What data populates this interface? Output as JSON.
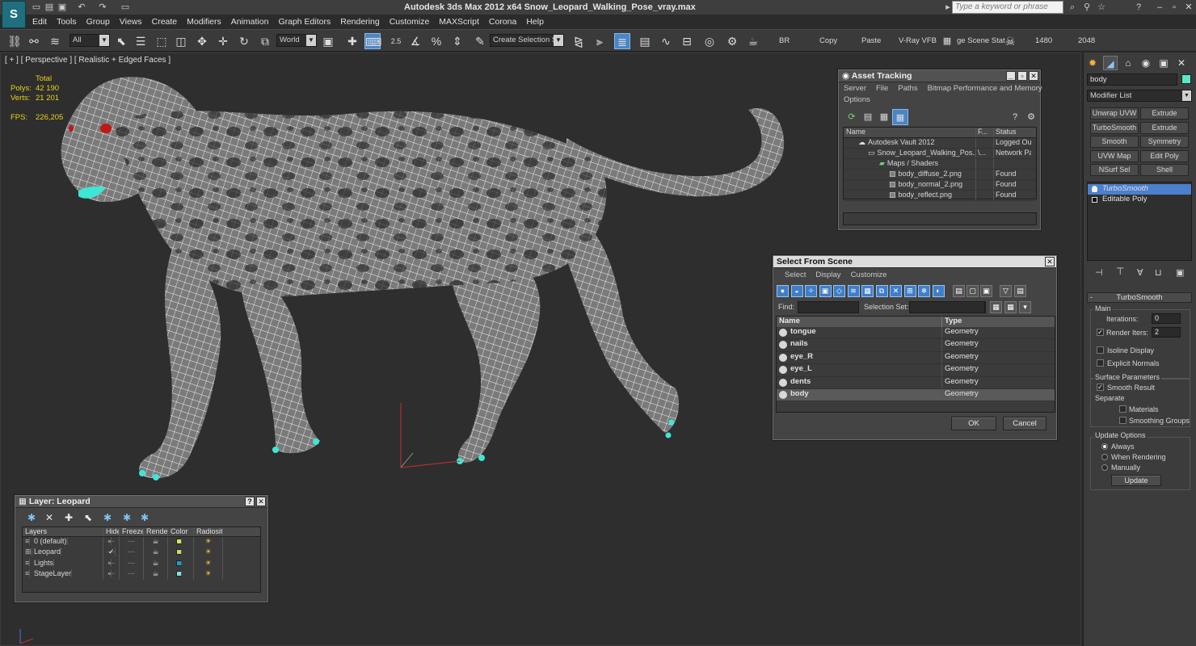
{
  "app": {
    "title": "Autodesk 3ds Max  2012 x64      Snow_Leopard_Walking_Pose_vray.max",
    "logo": "S",
    "search_placeholder": "Type a keyword or phrase"
  },
  "menu": [
    "Edit",
    "Tools",
    "Group",
    "Views",
    "Create",
    "Modifiers",
    "Animation",
    "Graph Editors",
    "Rendering",
    "Customize",
    "MAXScript",
    "Corona",
    "Help"
  ],
  "toolbar": {
    "filter": "All",
    "coord": "World",
    "selection_set": "Create Selection Se",
    "snap_num": "2.5",
    "labels": [
      "BR",
      "Copy",
      "Paste",
      "V-Ray VFB",
      "ge Scene Stat",
      "1480",
      "2048"
    ]
  },
  "viewport": {
    "label": "[ + ] [ Perspective ] [ Realistic + Edged Faces ]",
    "stats": {
      "total_label": "Total",
      "polys_label": "Polys:",
      "polys": "42 190",
      "verts_label": "Verts:",
      "verts": "21 201",
      "fps_label": "FPS:",
      "fps": "226,205"
    }
  },
  "asset_tracking": {
    "title": "Asset Tracking",
    "menu": [
      "Server",
      "File",
      "Paths",
      "Bitmap Performance and Memory"
    ],
    "menu2": "Options",
    "columns": [
      "Name",
      "F...",
      "Status"
    ],
    "rows": [
      {
        "name": "Autodesk Vault 2012",
        "f": "",
        "status": "Logged Out"
      },
      {
        "name": "Snow_Leopard_Walking_Pos...",
        "f": "\\...",
        "status": "Network Pa"
      },
      {
        "name": "Maps / Shaders",
        "f": "",
        "status": ""
      },
      {
        "name": "body_diffuse_2.png",
        "f": "",
        "status": "Found"
      },
      {
        "name": "body_normal_2.png",
        "f": "",
        "status": "Found"
      },
      {
        "name": "body_reflect.png",
        "f": "",
        "status": "Found"
      }
    ]
  },
  "select_from_scene": {
    "title": "Select From Scene",
    "menu": [
      "Select",
      "Display",
      "Customize"
    ],
    "find_label": "Find:",
    "selection_set_label": "Selection Set:",
    "columns": [
      "Name",
      "Type"
    ],
    "rows": [
      {
        "name": "tongue",
        "type": "Geometry"
      },
      {
        "name": "nails",
        "type": "Geometry"
      },
      {
        "name": "eye_R",
        "type": "Geometry"
      },
      {
        "name": "eye_L",
        "type": "Geometry"
      },
      {
        "name": "dents",
        "type": "Geometry"
      },
      {
        "name": "body",
        "type": "Geometry"
      }
    ],
    "ok": "OK",
    "cancel": "Cancel"
  },
  "layer_dialog": {
    "title": "Layer: Leopard",
    "columns": [
      "Layers",
      "Hide",
      "Freeze",
      "Render",
      "Color",
      "Radiosity"
    ],
    "rows": [
      {
        "name": "0 (default)",
        "color": "#d9e84a",
        "current": false
      },
      {
        "name": "Leopard",
        "color": "#c7e05a",
        "current": true
      },
      {
        "name": "Lights",
        "color": "#1e9bd6",
        "current": false
      },
      {
        "name": "StageLayer",
        "color": "#7fe0e0",
        "current": false
      }
    ]
  },
  "command_panel": {
    "object_name": "body",
    "object_color": "#58e8c8",
    "modifier_list": "Modifier List",
    "mod_buttons": [
      "Unwrap UVW",
      "Extrude",
      "TurboSmooth",
      "Extrude",
      "Smooth",
      "Symmetry",
      "UVW Map",
      "Edit Poly",
      "NSurf Sel",
      "Shell"
    ],
    "stack": [
      "TurboSmooth",
      "Editable Poly"
    ],
    "rollout_title": "TurboSmooth",
    "main_label": "Main",
    "iterations_label": "Iterations:",
    "iterations": "0",
    "render_iters_label": "Render Iters:",
    "render_iters": "2",
    "isoline": "Isoline Display",
    "explicit_normals": "Explicit Normals",
    "surface_params": "Surface Parameters",
    "smooth_result": "Smooth Result",
    "separate": "Separate",
    "materials": "Materials",
    "smoothing_groups": "Smoothing Groups",
    "update_options": "Update Options",
    "always": "Always",
    "when_rendering": "When Rendering",
    "manually": "Manually",
    "update_button": "Update"
  }
}
